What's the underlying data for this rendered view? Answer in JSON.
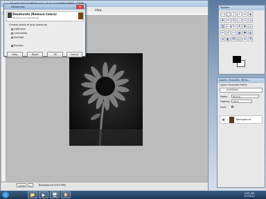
{
  "image_window": {
    "title": "[Untitled]-1.0 (RGB color, 1 layer) 3000x4000 – GIMP",
    "menu_visible": "View",
    "zoom": "100%",
    "unit": "px",
    "status": "Background (55.9 MB)"
  },
  "dialog": {
    "title": "Desaturate",
    "close_label": "✕",
    "header_title": "Desaturate (Remove Colors)",
    "header_sub": "Background-5 ([Untitled])",
    "section_label": "Choose shade of gray based on",
    "options": [
      {
        "label": "Lightness",
        "selected": true
      },
      {
        "label": "Luminosity",
        "selected": false
      },
      {
        "label": "Average",
        "selected": false
      }
    ],
    "preview_label": "Preview",
    "buttons": {
      "help": "Help",
      "reset": "Reset",
      "ok": "OK",
      "cancel": "Cancel"
    }
  },
  "toolbox": {
    "title": "Toolbox",
    "tools": [
      "▭",
      "◯",
      "ʃ",
      "✧",
      "⌖",
      "◈",
      "✥",
      "⌗",
      "⟲",
      "▱",
      "✂",
      "⇲",
      "⧉",
      "⟷",
      "✎",
      "A",
      "✚",
      "⌀",
      "✏",
      "✐",
      "✑",
      "◉",
      "✱",
      "◍",
      "⊚",
      "◐",
      "⌘",
      "◎",
      "✦",
      "⚗"
    ],
    "fg_color": "#000000",
    "bg_color": "#ffffff"
  },
  "layers": {
    "title": "Layers, Channels, Paths...",
    "tabs": "Layers  Channels  Paths",
    "image_selector": "[Untitled]",
    "mode_label": "Mode:",
    "mode_value": "Normal",
    "opacity_label": "Opacity:",
    "opacity_value": "100.0",
    "lock_label": "Lock:",
    "layer_name": "Background"
  },
  "taskbar": {
    "apps": [
      "📁",
      "▶",
      "🖥",
      "🐶"
    ],
    "time": "3:35 AM",
    "date": "7/1/2012"
  }
}
